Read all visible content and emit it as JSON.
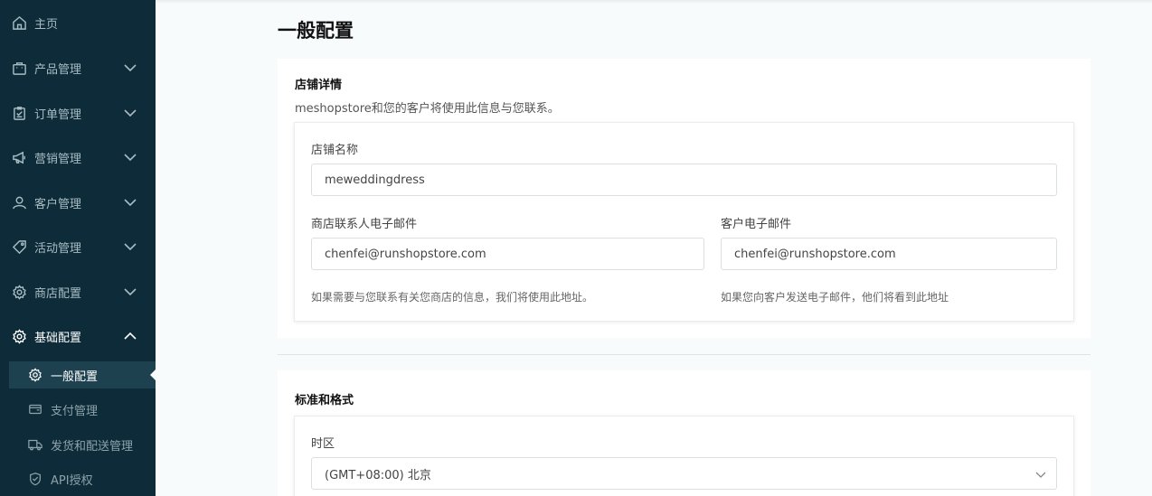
{
  "sidebar": {
    "items": [
      {
        "label": "主页",
        "icon": "home-icon"
      },
      {
        "label": "产品管理",
        "icon": "bag-icon"
      },
      {
        "label": "订单管理",
        "icon": "clipboard-icon"
      },
      {
        "label": "营销管理",
        "icon": "megaphone-icon"
      },
      {
        "label": "客户管理",
        "icon": "user-icon"
      },
      {
        "label": "活动管理",
        "icon": "tag-icon"
      },
      {
        "label": "商店配置",
        "icon": "gear-icon"
      },
      {
        "label": "基础配置",
        "icon": "gear-icon"
      }
    ],
    "sub_items": [
      {
        "label": "一般配置",
        "icon": "gear-icon"
      },
      {
        "label": "支付管理",
        "icon": "wallet-icon"
      },
      {
        "label": "发货和配送管理",
        "icon": "truck-icon"
      },
      {
        "label": "API授权",
        "icon": "shield-icon"
      }
    ]
  },
  "page": {
    "title": "一般配置"
  },
  "store_details": {
    "title": "店铺详情",
    "description": "meshopstore和您的客户将使用此信息与您联系。",
    "store_name_label": "店铺名称",
    "store_name_value": "meweddingdress",
    "contact_email_label": "商店联系人电子邮件",
    "contact_email_value": "chenfei@runshopstore.com",
    "contact_email_hint": "如果需要与您联系有关您商店的信息，我们将使用此地址。",
    "customer_email_label": "客户电子邮件",
    "customer_email_value": "chenfei@runshopstore.com",
    "customer_email_hint": "如果您向客户发送电子邮件，他们将看到此地址"
  },
  "standards": {
    "title": "标准和格式",
    "timezone_label": "时区",
    "timezone_value": "(GMT+08:00) 北京"
  }
}
